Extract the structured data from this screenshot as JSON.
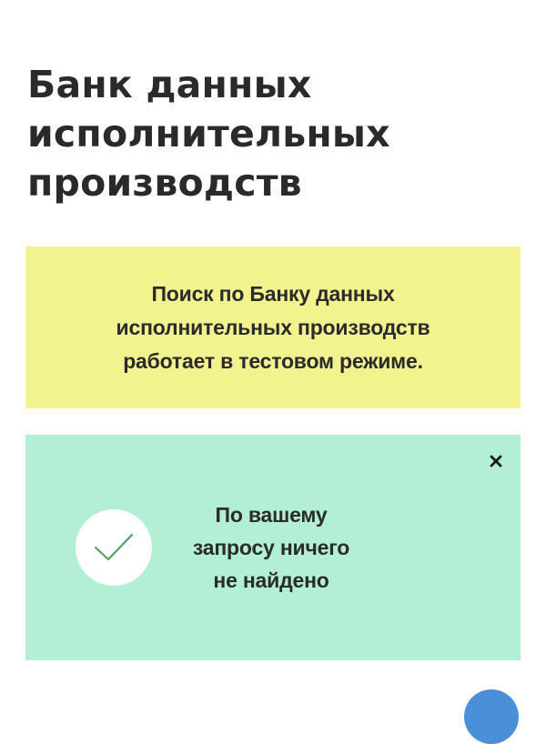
{
  "header": {
    "title": "Банк данных\nисполнительных\nпроизводств"
  },
  "test_notice": {
    "text": "Поиск по Банку данных\nисполнительных производств\nработает в тестовом режиме.",
    "background": "#f2f28e"
  },
  "result": {
    "message": "По вашему\nзапросу ничего\nне найдено",
    "background": "#b3efd5",
    "check_color": "#5a9e63",
    "icon": "check-icon",
    "close_icon": "close-icon"
  },
  "scroll_top": {
    "color": "#4a8fd8"
  }
}
